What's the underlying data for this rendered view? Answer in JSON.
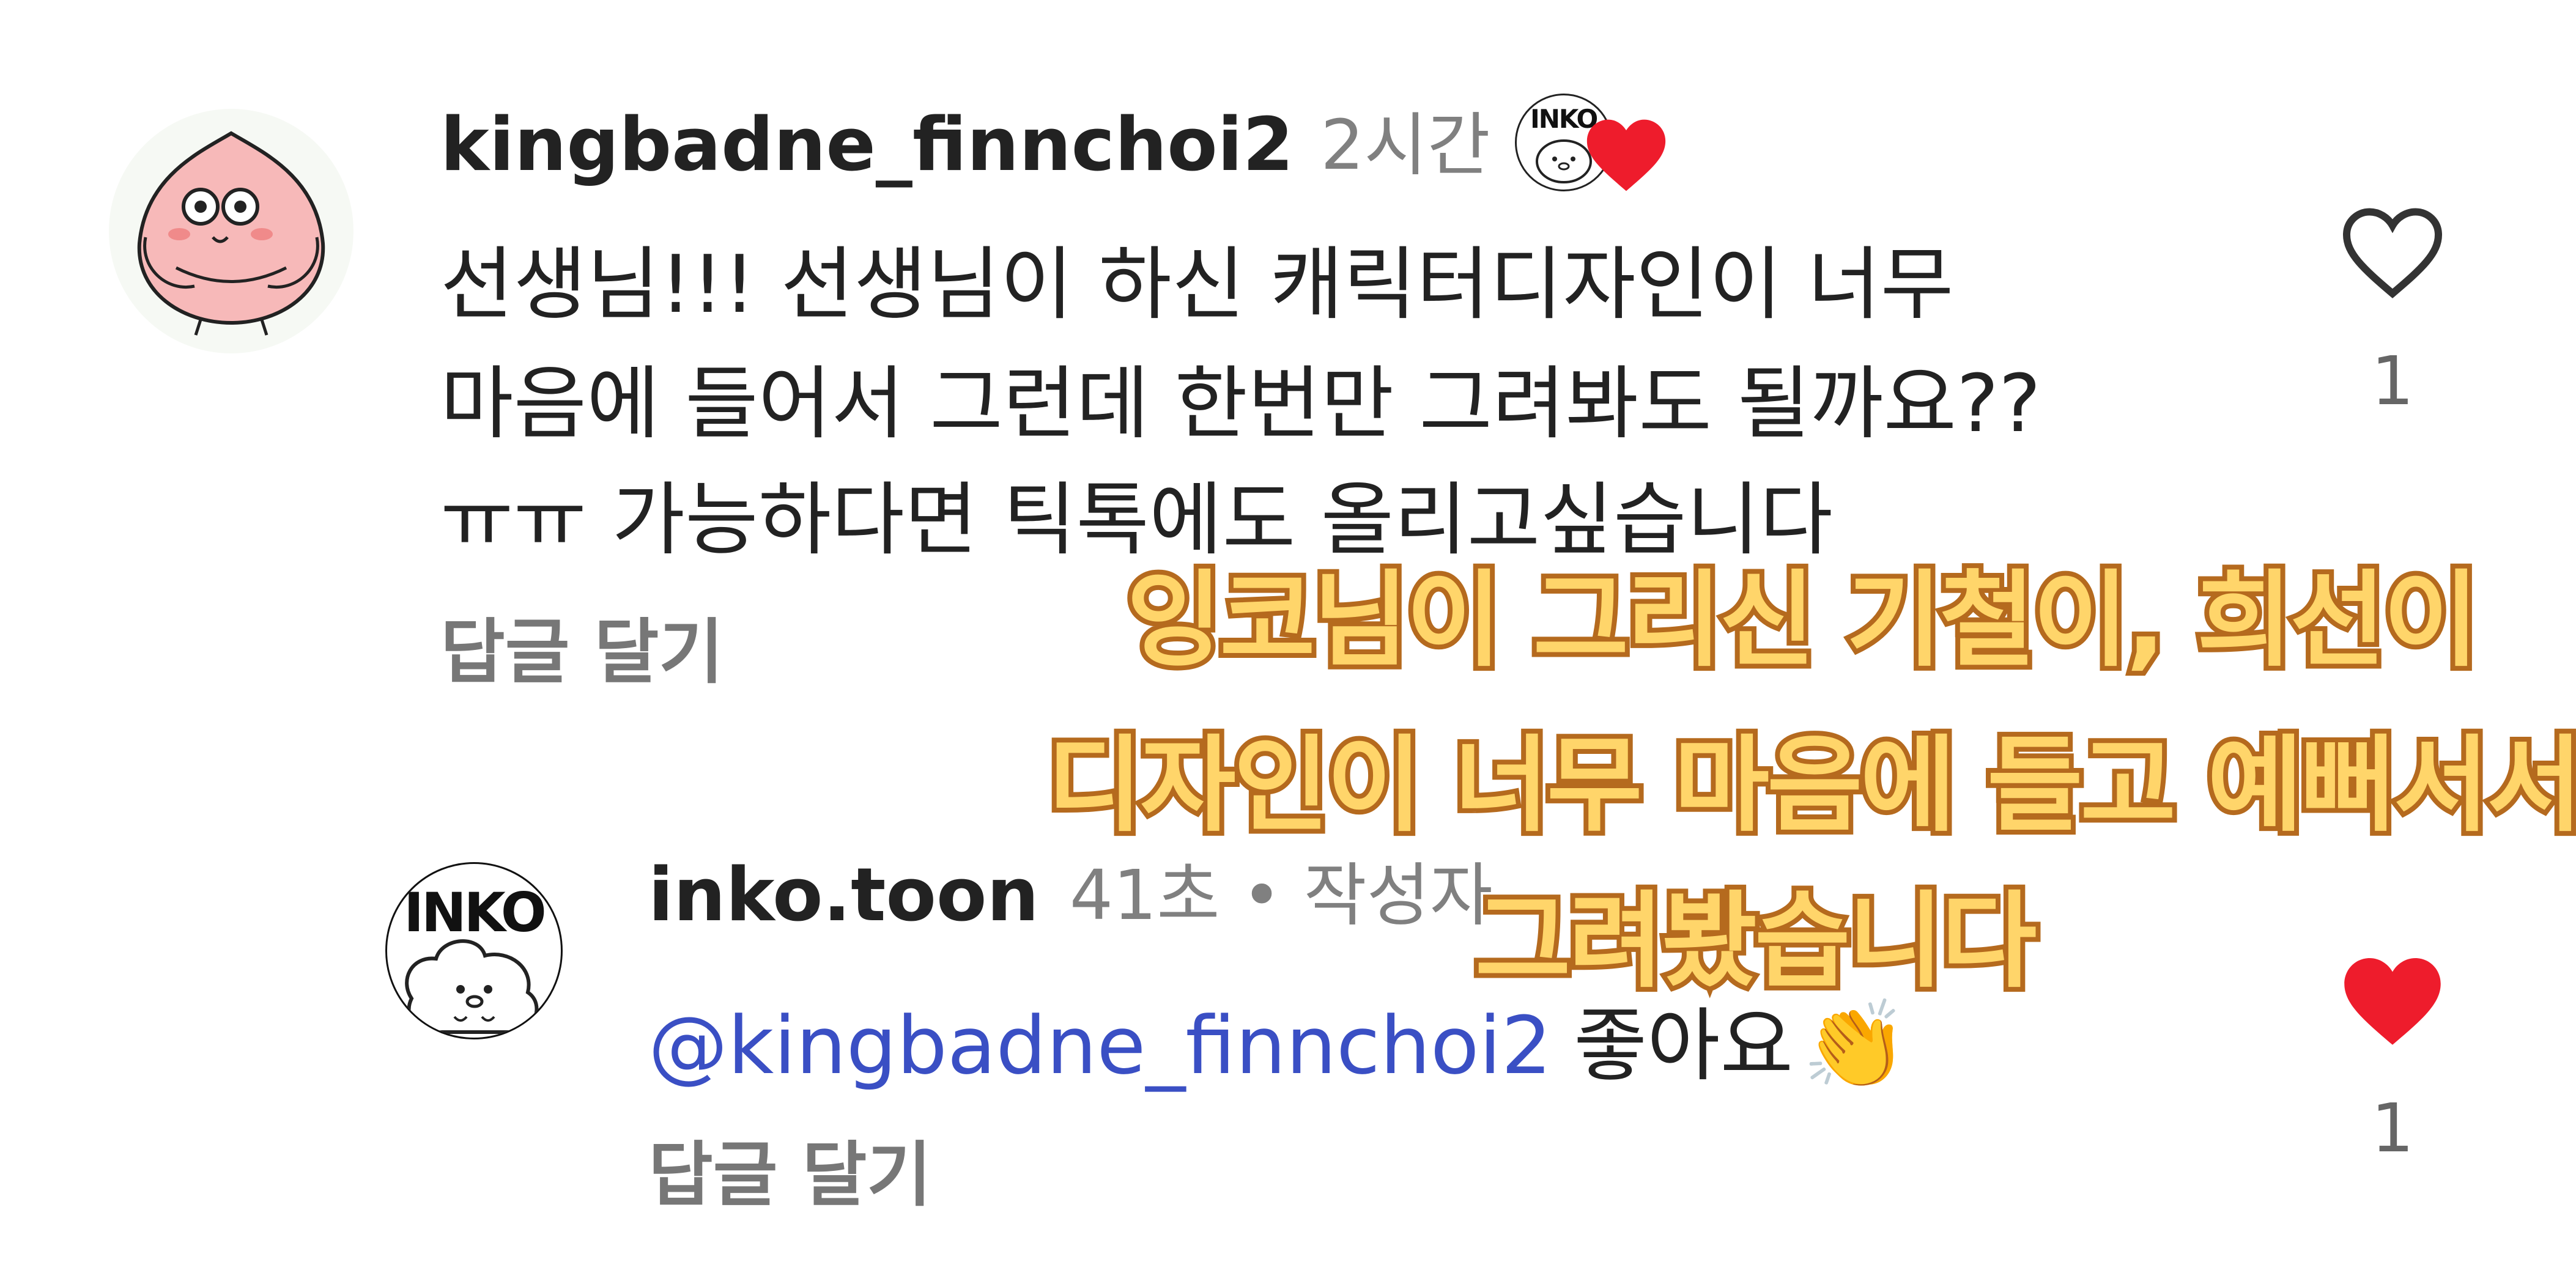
{
  "comment": {
    "username": "kingbadne_finnchoi2",
    "time": "2시간",
    "body_lines": [
      "선생님!!! 선생님이 하신 캐릭터디자인이 너무",
      "마음에 들어서 그런데 한번만 그려봐도 될까요??",
      "ㅠㅠ 가능하다면 틱톡에도 올리고싶습니다"
    ],
    "reply_label": "답글 달기",
    "like_count": "1",
    "creator_badge_text": "INKO",
    "liked_by_creator": true,
    "avatar_icon": "peach-character-icon"
  },
  "reply": {
    "username": "inko.toon",
    "meta": "41초 • 작성자",
    "mention": "@kingbadne_finnchoi2",
    "text": "좋아요",
    "emoji": "👏",
    "reply_label": "답글 달기",
    "like_count": "1",
    "liked": true,
    "avatar_text": "INKO",
    "avatar_icon": "inko-character-icon"
  },
  "overlay_caption": {
    "lines": [
      "잉코님이 그리신 기철이, 희선이",
      "디자인이 너무 마음에 들고 예뻐서서",
      "그려봤습니다"
    ]
  },
  "colors": {
    "heart_red": "#ee1c2c",
    "mention_blue": "#3a4fc4",
    "caption_fill": "#ffd56a",
    "caption_outline": "#b56a1e"
  }
}
